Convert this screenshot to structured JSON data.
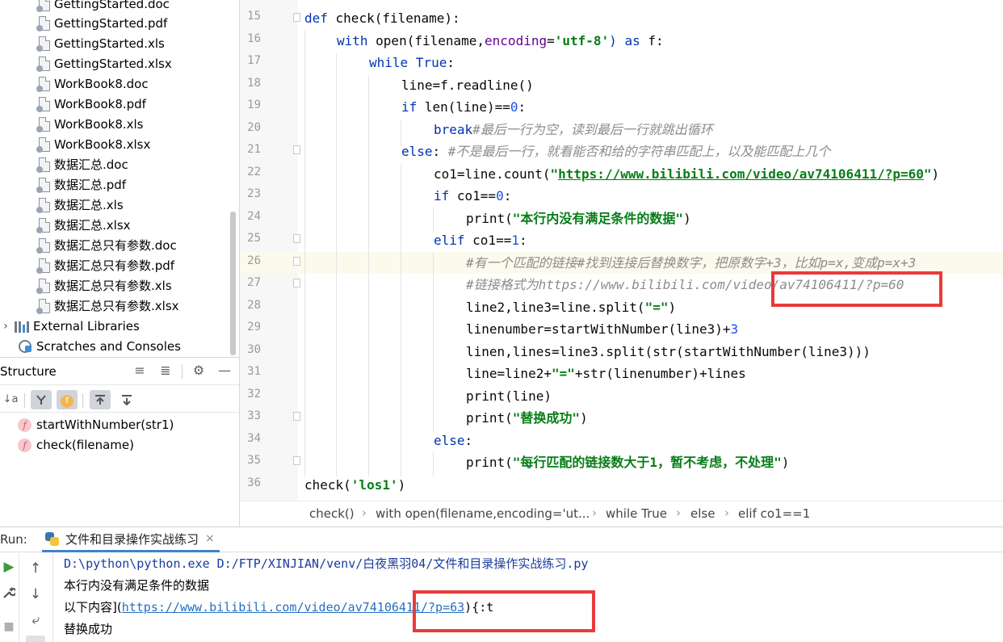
{
  "project_tree": {
    "files": [
      "GettingStarted.doc",
      "GettingStarted.pdf",
      "GettingStarted.xls",
      "GettingStarted.xlsx",
      "WorkBook8.doc",
      "WorkBook8.pdf",
      "WorkBook8.xls",
      "WorkBook8.xlsx",
      "数据汇总.doc",
      "数据汇总.pdf",
      "数据汇总.xls",
      "数据汇总.xlsx",
      "数据汇总只有参数.doc",
      "数据汇总只有参数.pdf",
      "数据汇总只有参数.xls",
      "数据汇总只有参数.xlsx"
    ],
    "external_libraries": "External Libraries",
    "scratches": "Scratches and Consoles"
  },
  "structure": {
    "title": "Structure",
    "items": [
      "startWithNumber(str1)",
      "check(filename)"
    ],
    "fn_badge": "f"
  },
  "editor": {
    "line_numbers": [
      "15",
      "16",
      "17",
      "18",
      "19",
      "20",
      "21",
      "22",
      "23",
      "24",
      "25",
      "26",
      "27",
      "28",
      "29",
      "30",
      "31",
      "32",
      "33",
      "34",
      "35",
      "36"
    ],
    "code": {
      "l15_kw": "def",
      "l15_rest": " check(filename):",
      "l16_kw": "with",
      "l16_open": " open(filename,",
      "l16_param": "encoding",
      "l16_eq": "=",
      "l16_str": "'utf-8'",
      "l16_as": ") as",
      "l16_end": " f:",
      "l17_kw": "while",
      "l17_true": " True",
      "l17_end": ":",
      "l18": "line=f.readline()",
      "l19_kw": "if",
      "l19_mid": " len(line)==",
      "l19_num": "0",
      "l19_end": ":",
      "l20_kw": "break",
      "l20_cmt": "#最后一行为空，读到最后一行就跳出循环",
      "l21_kw": "else",
      "l21_colon": ": ",
      "l21_cmt": "#不是最后一行，就看能否和给的字符串匹配上，以及能匹配上几个",
      "l22_pre": "co1=line.count(",
      "l22_q1": "\"",
      "l22_link": "https://www.bilibili.com/video/av74106411/?p=60",
      "l22_q2": "\"",
      "l22_end": ")",
      "l23_kw": "if",
      "l23_mid": " co1==",
      "l23_num": "0",
      "l23_end": ":",
      "l24_pre": "print(",
      "l24_str": "\"本行内没有满足条件的数据\"",
      "l24_end": ")",
      "l25_kw": "elif",
      "l25_mid": " co1==",
      "l25_num": "1",
      "l25_end": ":",
      "l26_cmt": "#有一个匹配的链接#找到连接后替换数字，把原数字+3，比如p=x,变成p=x+3",
      "l27_cmt": "#链接格式为https://www.bilibili.com/video/av74106411/?p=60",
      "l28_pre": "line2,line3=line.split(",
      "l28_str": "\"=\"",
      "l28_end": ")",
      "l29_pre": "linenumber=startWithNumber(line3)+",
      "l29_num": "3",
      "l30": "linen,lines=line3.split(str(startWithNumber(line3)))",
      "l31_pre": "line=line2+",
      "l31_str": "\"=\"",
      "l31_end": "+str(linenumber)+lines",
      "l32": "print(line)",
      "l33_pre": "print(",
      "l33_str": "\"替换成功\"",
      "l33_end": ")",
      "l34_kw": "else",
      "l34_end": ":",
      "l35_pre": "print(",
      "l35_str": "\"每行匹配的链接数大于1，暂不考虑，不处理\"",
      "l35_end": ")",
      "l36_pre": "check(",
      "l36_str": "'los1'",
      "l36_end": ")"
    }
  },
  "breadcrumbs": [
    "check()",
    "with open(filename,encoding='ut...",
    "while True",
    "else",
    "elif co1==1"
  ],
  "breadcrumb_sep": "›",
  "run": {
    "label": "Run:",
    "tab": "文件和目录操作实战练习",
    "tab_close": "×",
    "console": {
      "cmd": "D:\\python\\python.exe D:/FTP/XINJIAN/venv/白夜黑羽04/文件和目录操作实战练习.py",
      "out1": "本行内没有满足条件的数据",
      "out2_pre": "以下内容](",
      "out2_link": "https://www.bilibili.com/video/av74106411/?p=63",
      "out2_post": "){:t",
      "out3": "替换成功"
    }
  },
  "icons": {
    "run": "▶",
    "wrench": "🔧",
    "stop": "■",
    "up": "↑",
    "down": "↓",
    "wrap": "⤶",
    "gear": "⚙",
    "minimize": "—",
    "expand": "≡",
    "collapse": "≣",
    "sort": "↓a"
  },
  "colors": {
    "keyword": "#0033b3",
    "string": "#067d17",
    "number": "#1750eb",
    "comment": "#8c8c8c",
    "annotation_red": "#e83b3b",
    "current_line": "#fcfaed"
  }
}
